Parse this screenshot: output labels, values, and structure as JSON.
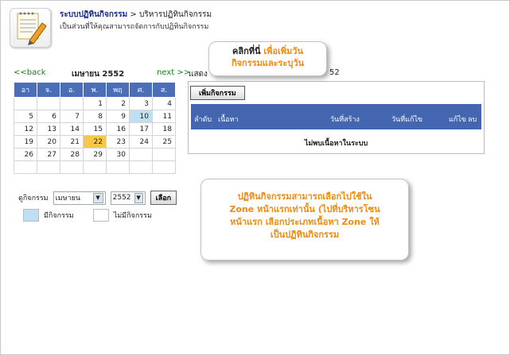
{
  "header": {
    "breadcrumb_link": "ระบบปฏิทินกิจกรรม",
    "breadcrumb_sep": " > ",
    "breadcrumb_current": "บริหารปฏิทินกิจกรรม",
    "subtitle": "เป็นส่วนที่ให้คุณสามารถจัดการกับปฏิทินกิจกรรม"
  },
  "nav": {
    "back": "<<back",
    "month": "เมษายน 2552",
    "next": "next >>",
    "show_prefix": "แสดง",
    "show_suffix": "52"
  },
  "calendar": {
    "weekdays": [
      "อา",
      "จ.",
      "อ.",
      "พ.",
      "พฤ",
      "ศ.",
      "ส."
    ],
    "rows": [
      [
        "",
        "",
        "",
        "1",
        "2",
        "3",
        "4"
      ],
      [
        "5",
        "6",
        "7",
        "8",
        "9",
        "10",
        "11"
      ],
      [
        "12",
        "13",
        "14",
        "15",
        "16",
        "17",
        "18"
      ],
      [
        "19",
        "20",
        "21",
        "22",
        "23",
        "24",
        "25"
      ],
      [
        "26",
        "27",
        "28",
        "29",
        "30",
        "",
        ""
      ],
      [
        "",
        "",
        "",
        "",
        "",
        "",
        ""
      ]
    ]
  },
  "filter": {
    "label": "ดูกิจกรรม",
    "month_value": "เมษายน",
    "year_value": "2552",
    "select_button": "เลือก"
  },
  "legend": {
    "has_event": "มีกิจกรรม",
    "no_event": "ไม่มีกิจกรรม"
  },
  "panel": {
    "add_button": "เพิ่มกิจกรรม",
    "columns": [
      "ลำดับ",
      "เนื้อหา",
      "วันที่สร้าง",
      "วันที่แก้ไข",
      "แก้ไข",
      "ลบ"
    ],
    "empty_message": "ไม่พบเนื้อหาในระบบ"
  },
  "callouts": {
    "top_line1_a": "คลิกที่นี่",
    "top_line1_b": " เพื่อเพิ่มวัน",
    "top_line2": "กิจกรรมและระบุวัน",
    "bottom_lines": [
      "ปฏิทินกิจกรรมสามารถเลือกไปใช้ใน",
      "Zone หน้าแรกเท่านั้น (ไปที่บริหารโซน",
      "หน้าแรก เลือกประเภทเนื้อหา Zone ให้",
      "เป็นปฏิทินกิจกรรม"
    ]
  },
  "colors": {
    "header_blue": "#4a6fb8",
    "event": "#bfe0f2",
    "today": "#f5c84a",
    "callout_orange": "#ef8a10"
  }
}
